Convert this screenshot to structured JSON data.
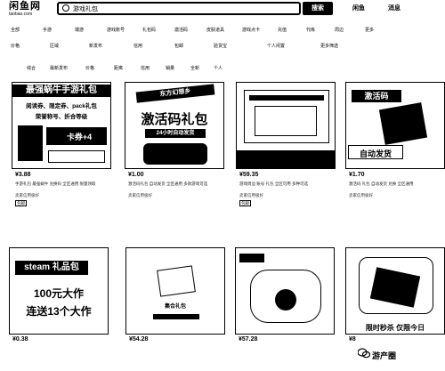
{
  "header": {
    "logo_main": "闲鱼网",
    "logo_sub": "taobao.com",
    "search_text": "游戏礼包",
    "search_button": "搜索",
    "link_1": "闲鱼",
    "link_2": "消息"
  },
  "nav_row_1": [
    "全部",
    "手游",
    "端游",
    "游戏账号",
    "礼包码",
    "激活码",
    "皮肤道具",
    "游戏点卡",
    "充值",
    "代练",
    "周边",
    "更多"
  ],
  "nav_row_2": [
    "价格",
    "区域",
    "新发布",
    "信用",
    "包邮",
    "验货宝",
    "个人闲置",
    "更多筛选"
  ],
  "nav_row_3": [
    "综合",
    "最新发布",
    "价格",
    "距离",
    "信用",
    "销量",
    "全新",
    "个人"
  ],
  "products": [
    {
      "banner": "最强蜗牛手游礼包",
      "art_line_1": "阅读券、限定券、pack礼包",
      "art_line_2": "荣誉称号、折合等级",
      "art_line_3": "卡券+4",
      "price": "¥3.88",
      "desc": "手游礼包 最强蜗牛 兑换码 全区通用 限量领取",
      "seller": "卖家信用极好",
      "tag": "包邮"
    },
    {
      "banner": "东方幻想乡",
      "art_line_1": "激活码礼包",
      "art_line_2": "24小时自动发货",
      "art_line_3": "",
      "price": "¥1.00",
      "desc": "激活码礼包 自动发货 全区通用 多款游戏可选",
      "seller": "卖家信用极好",
      "tag": ""
    },
    {
      "banner": "",
      "art_line_1": "",
      "art_line_2": "",
      "art_line_3": "",
      "price": "¥59.35",
      "desc": "游戏周边 账号 礼包 全区可用 多种可选",
      "seller": "卖家信用极好",
      "tag": "包邮"
    },
    {
      "banner": "激活码",
      "art_line_1": "自动发货",
      "art_line_2": "",
      "art_line_3": "",
      "price": "¥1.70",
      "desc": "激活码 礼包 自动发货 兑换 全区通用",
      "seller": "卖家信用极好",
      "tag": ""
    },
    {
      "banner": "steam 礼品包",
      "art_line_1": "100元大作",
      "art_line_2": "连送13个大作",
      "art_line_3": "",
      "price": "¥0.38",
      "desc": "",
      "seller": "",
      "tag": ""
    },
    {
      "banner": "",
      "art_line_1": "集合礼包",
      "art_line_2": "",
      "art_line_3": "",
      "price": "¥54.28",
      "desc": "",
      "seller": "",
      "tag": ""
    },
    {
      "banner": "",
      "art_line_1": "",
      "art_line_2": "",
      "art_line_3": "",
      "price": "¥57.28",
      "desc": "",
      "seller": "",
      "tag": ""
    },
    {
      "banner": "",
      "art_line_1": "限时秒杀 仅限今日",
      "art_line_2": "",
      "art_line_3": "",
      "price": "¥8",
      "desc": "",
      "seller": "",
      "tag": ""
    }
  ],
  "watermark": "游产圈"
}
